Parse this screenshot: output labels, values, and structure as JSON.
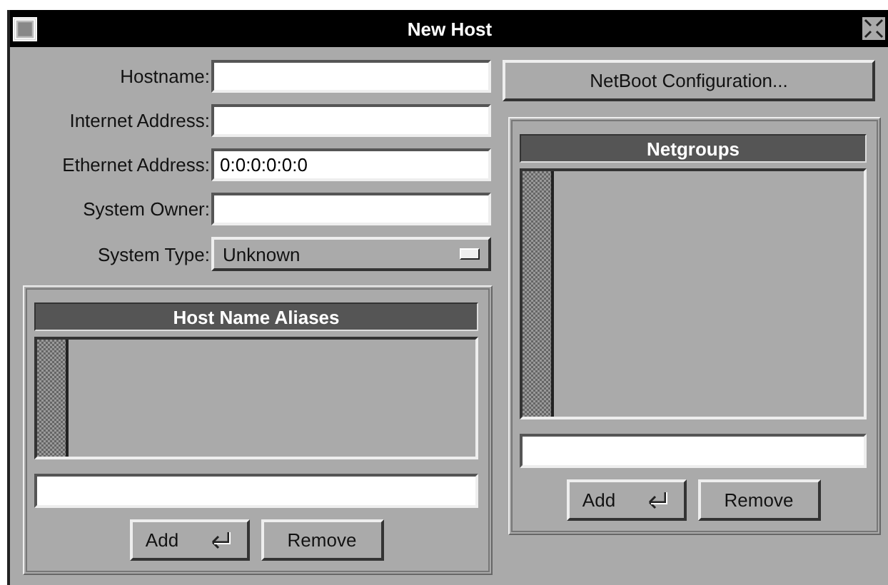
{
  "window": {
    "title": "New Host"
  },
  "fields": [
    {
      "label": "Hostname:"
    },
    {
      "label": "Internet Address:"
    },
    {
      "label": "Ethernet Address:",
      "value": "0:0:0:0:0:0"
    },
    {
      "label": "System Owner:"
    }
  ],
  "system_type": {
    "label": "System Type:",
    "value": "Unknown"
  },
  "netboot_button": "NetBoot Configuration...",
  "lists": [
    {
      "title": "Host Name Aliases",
      "buttons": [
        {
          "label": "Add",
          "kind": "enter"
        },
        {
          "label": "Remove",
          "kind": "plain"
        }
      ]
    },
    {
      "title": "Netgroups",
      "buttons": [
        {
          "label": "Add",
          "kind": "enter"
        },
        {
          "label": "Remove",
          "kind": "plain"
        }
      ]
    }
  ]
}
